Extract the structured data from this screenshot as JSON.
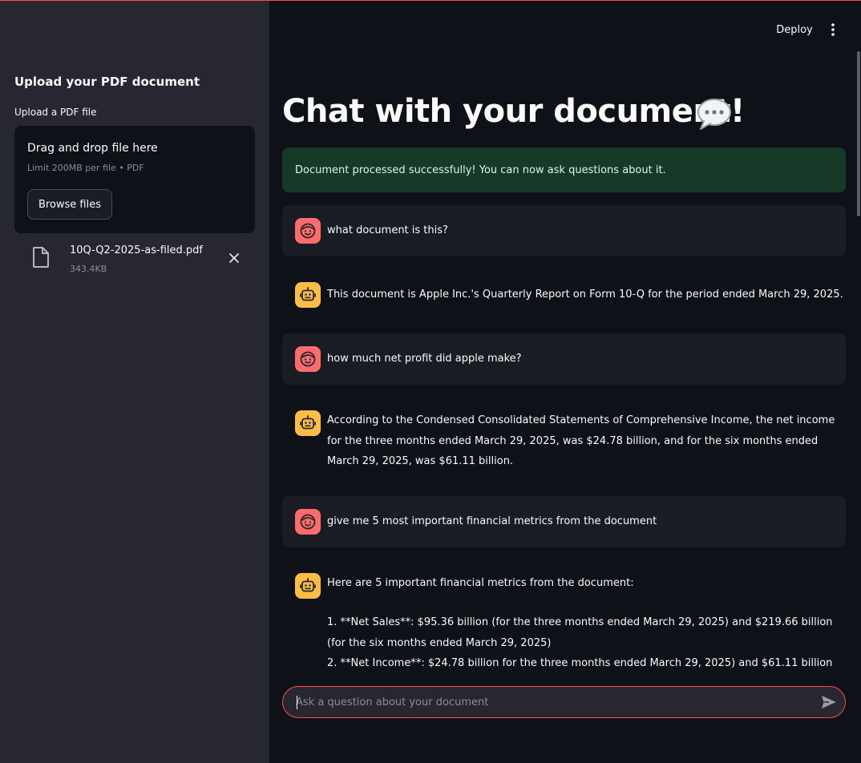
{
  "header": {
    "deploy_label": "Deploy"
  },
  "sidebar": {
    "title": "Upload your PDF document",
    "uploader_label": "Upload a PDF file",
    "dropzone": {
      "title": "Drag and drop file here",
      "limit": "Limit 200MB per file • PDF",
      "browse_label": "Browse files"
    },
    "file": {
      "name": "10Q-Q2-2025-as-filed.pdf",
      "size": "343.4KB"
    }
  },
  "main": {
    "title": "Chat with your document!",
    "title_icon": "speech-bubble-icon",
    "success_message": "Document processed successfully! You can now ask questions about it.",
    "messages": [
      {
        "role": "user",
        "lines": [
          "what document is this?"
        ]
      },
      {
        "role": "assistant",
        "lines": [
          "This document is Apple Inc.'s Quarterly Report on Form 10-Q for the period ended March 29, 2025."
        ]
      },
      {
        "role": "user",
        "lines": [
          "how much net profit did apple make?"
        ]
      },
      {
        "role": "assistant",
        "lines": [
          "According to the Condensed Consolidated Statements of Comprehensive Income, the net income",
          "for the three months ended March 29, 2025, was $24.78 billion, and for the six months ended",
          "March 29, 2025, was $61.11 billion."
        ]
      },
      {
        "role": "user",
        "lines": [
          "give me 5 most important financial metrics from the document"
        ]
      },
      {
        "role": "assistant",
        "lines": [
          "Here are 5 important financial metrics from the document:",
          "",
          "1. **Net Sales**: $95.36 billion (for the three months ended March 29, 2025) and $219.66 billion",
          "(for the six months ended March 29, 2025)",
          "2. **Net Income**: $24.78 billion for the three months ended March 29, 2025) and $61.11 billion"
        ]
      }
    ]
  },
  "chat_input": {
    "placeholder": "Ask a question about your document"
  },
  "colors": {
    "background": "#0e1117",
    "sidebar": "#262730",
    "accent": "#ff4b4b",
    "user_avatar": "#ff6c6c",
    "assistant_avatar": "#ffbd45",
    "success_bg": "#173928"
  }
}
